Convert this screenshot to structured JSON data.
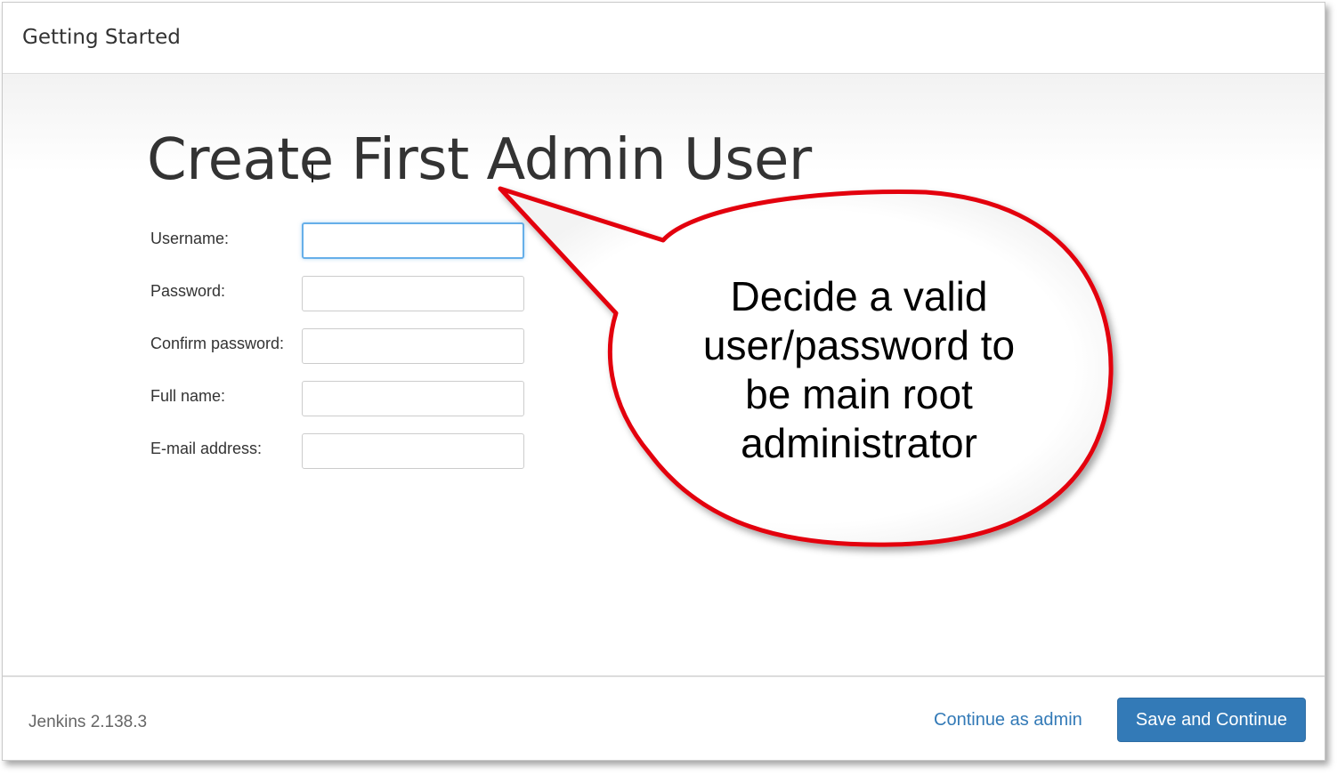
{
  "header": {
    "title": "Getting Started"
  },
  "main": {
    "title": "Create First Admin User",
    "form": {
      "fields": [
        {
          "label": "Username:",
          "value": "",
          "focused": true
        },
        {
          "label": "Password:",
          "value": ""
        },
        {
          "label": "Confirm password:",
          "value": ""
        },
        {
          "label": "Full name:",
          "value": ""
        },
        {
          "label": "E-mail address:",
          "value": ""
        }
      ]
    }
  },
  "callout": {
    "lines": [
      "Decide a valid",
      "user/password to",
      "be main root",
      "administrator"
    ],
    "border_color": "#e3000f"
  },
  "footer": {
    "version": "Jenkins 2.138.3",
    "continue_admin_label": "Continue as admin",
    "save_continue_label": "Save and Continue"
  },
  "colors": {
    "accent": "#337ab7",
    "focus": "#66afe9",
    "text": "#333333"
  }
}
